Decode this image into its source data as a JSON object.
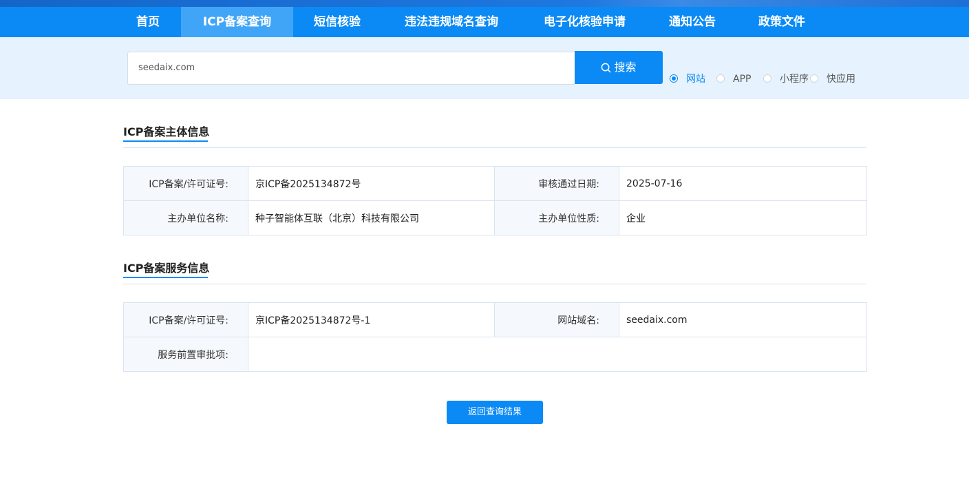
{
  "nav": {
    "items": [
      "首页",
      "ICP备案查询",
      "短信核验",
      "违法违规域名查询",
      "电子化核验申请",
      "通知公告",
      "政策文件"
    ],
    "active_index": 1
  },
  "search": {
    "value": "seedaix.com",
    "button_label": "搜索",
    "options": [
      "网站",
      "APP",
      "小程序",
      "快应用"
    ],
    "selected_option": "网站"
  },
  "subject_info": {
    "title": "ICP备案主体信息",
    "license_label": "ICP备案/许可证号:",
    "license_value": "京ICP备2025134872号",
    "approval_date_label": "审核通过日期:",
    "approval_date_value": "2025-07-16",
    "org_name_label": "主办单位名称:",
    "org_name_value": "种子智能体互联（北京）科技有限公司",
    "org_type_label": "主办单位性质:",
    "org_type_value": "企业"
  },
  "service_info": {
    "title": "ICP备案服务信息",
    "license_label": "ICP备案/许可证号:",
    "license_value": "京ICP备2025134872号-1",
    "domain_label": "网站域名:",
    "domain_value": "seedaix.com",
    "preapproval_label": "服务前置审批项:",
    "preapproval_value": ""
  },
  "back_button_label": "返回查询结果",
  "colors": {
    "primary": "#0b8af5",
    "nav_active": "#41a5f7",
    "search_band": "#e6f2fd",
    "label_bg": "#f5f9fd"
  }
}
